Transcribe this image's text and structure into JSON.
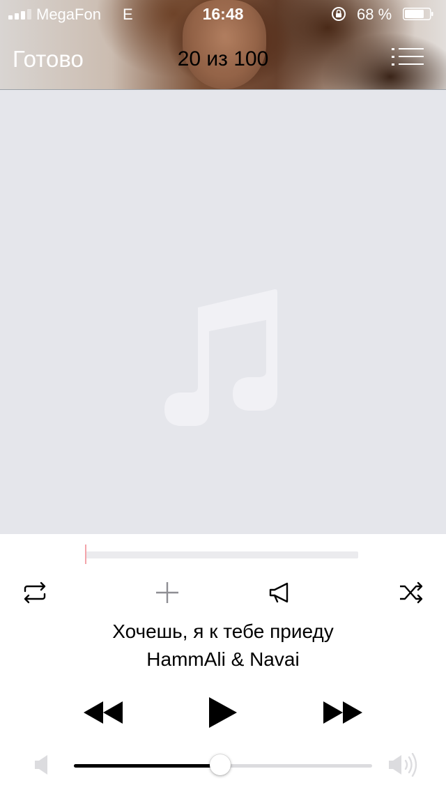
{
  "status_bar": {
    "carrier": "MegaFon",
    "network": "E",
    "time": "16:48",
    "battery_percent": "68 %",
    "icons": [
      "signal-icon",
      "rotation-lock-icon",
      "battery-icon"
    ]
  },
  "nav": {
    "done_label": "Готово",
    "track_counter": "20 из 100",
    "playlist_icon": "playlist-icon"
  },
  "artwork": {
    "placeholder_icon": "music-note-icon",
    "background_color": "#e5e6eb"
  },
  "playback": {
    "progress_fraction": 0.0,
    "progress_color": "#f3a4aa"
  },
  "actions": {
    "icons": [
      "repeat-icon",
      "add-icon",
      "broadcast-icon",
      "shuffle-icon"
    ]
  },
  "track": {
    "title": "Хочешь, я к тебе приеду",
    "artist": "HammAli & Navai"
  },
  "transport": {
    "icons": [
      "rewind-icon",
      "play-icon",
      "fast-forward-icon"
    ]
  },
  "volume": {
    "level_fraction": 0.49,
    "icons": [
      "volume-low-icon",
      "volume-high-icon"
    ]
  }
}
